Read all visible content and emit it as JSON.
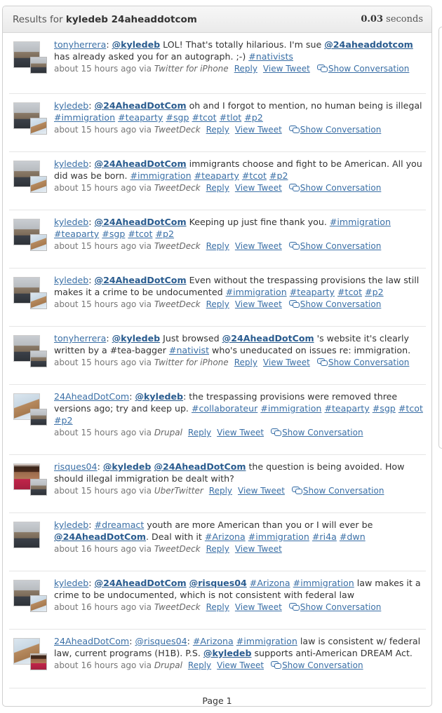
{
  "header": {
    "prefix": "Results for",
    "query": "kyledeb 24aheaddotcom",
    "time_value": "0.03",
    "time_unit": "seconds"
  },
  "meta_labels": {
    "reply": "Reply",
    "view": "View Tweet",
    "show": "Show Conversation",
    "via": "via"
  },
  "tweets": [
    {
      "user": "tonyherrera",
      "ago": "about 15 hours ago",
      "source": "Twitter for iPhone",
      "av1": "man",
      "av2": "man",
      "parts": [
        {
          "t": "user",
          "v": "tonyherrera"
        },
        {
          "t": "txt",
          "v": ": "
        },
        {
          "t": "mention",
          "v": "@kyledeb"
        },
        {
          "t": "txt",
          "v": " LOL! That's totally hilarious. I'm sue "
        },
        {
          "t": "mention",
          "v": "@24aheaddotcom"
        },
        {
          "t": "txt",
          "v": " has already asked you for an autograph. ;-) "
        },
        {
          "t": "hash",
          "v": "#nativists"
        }
      ],
      "show": true
    },
    {
      "user": "kyledeb",
      "ago": "about 15 hours ago",
      "source": "TweetDeck",
      "av1": "man",
      "av2": "liberty",
      "parts": [
        {
          "t": "user",
          "v": "kyledeb"
        },
        {
          "t": "txt",
          "v": ": "
        },
        {
          "t": "mention",
          "v": "@24AheadDotCom"
        },
        {
          "t": "txt",
          "v": " oh and I forgot to mention, no human being is illegal "
        },
        {
          "t": "hash",
          "v": "#immigration"
        },
        {
          "t": "txt",
          "v": " "
        },
        {
          "t": "hash",
          "v": "#teaparty"
        },
        {
          "t": "txt",
          "v": " "
        },
        {
          "t": "hash",
          "v": "#sgp"
        },
        {
          "t": "txt",
          "v": " "
        },
        {
          "t": "hash",
          "v": "#tcot"
        },
        {
          "t": "txt",
          "v": " "
        },
        {
          "t": "hash",
          "v": "#tlot"
        },
        {
          "t": "txt",
          "v": " "
        },
        {
          "t": "hash",
          "v": "#p2"
        }
      ],
      "show": true
    },
    {
      "user": "kyledeb",
      "ago": "about 15 hours ago",
      "source": "TweetDeck",
      "av1": "man",
      "av2": "liberty",
      "parts": [
        {
          "t": "user",
          "v": "kyledeb"
        },
        {
          "t": "txt",
          "v": ": "
        },
        {
          "t": "mention",
          "v": "@24AheadDotCom"
        },
        {
          "t": "txt",
          "v": " immigrants choose and fight to be American. All you did was be born. "
        },
        {
          "t": "hash",
          "v": "#immigration"
        },
        {
          "t": "txt",
          "v": " "
        },
        {
          "t": "hash",
          "v": "#teaparty"
        },
        {
          "t": "txt",
          "v": " "
        },
        {
          "t": "hash",
          "v": "#tcot"
        },
        {
          "t": "txt",
          "v": " "
        },
        {
          "t": "hash",
          "v": "#p2"
        }
      ],
      "show": true
    },
    {
      "user": "kyledeb",
      "ago": "about 15 hours ago",
      "source": "TweetDeck",
      "av1": "man",
      "av2": "liberty",
      "parts": [
        {
          "t": "user",
          "v": "kyledeb"
        },
        {
          "t": "txt",
          "v": ": "
        },
        {
          "t": "mention",
          "v": "@24AheadDotCom"
        },
        {
          "t": "txt",
          "v": " Keeping up just fine thank you. "
        },
        {
          "t": "hash",
          "v": "#immigration"
        },
        {
          "t": "txt",
          "v": " "
        },
        {
          "t": "hash",
          "v": "#teaparty"
        },
        {
          "t": "txt",
          "v": " "
        },
        {
          "t": "hash",
          "v": "#sgp"
        },
        {
          "t": "txt",
          "v": " "
        },
        {
          "t": "hash",
          "v": "#tcot"
        },
        {
          "t": "txt",
          "v": " "
        },
        {
          "t": "hash",
          "v": "#p2"
        }
      ],
      "show": true
    },
    {
      "user": "kyledeb",
      "ago": "about 15 hours ago",
      "source": "TweetDeck",
      "av1": "man",
      "av2": "liberty",
      "parts": [
        {
          "t": "user",
          "v": "kyledeb"
        },
        {
          "t": "txt",
          "v": ": "
        },
        {
          "t": "mention",
          "v": "@24AheadDotCom"
        },
        {
          "t": "txt",
          "v": " Even without the trespassing provisions the law still makes it a crime to be undocumented "
        },
        {
          "t": "hash",
          "v": "#immigration"
        },
        {
          "t": "txt",
          "v": " "
        },
        {
          "t": "hash",
          "v": "#teaparty"
        },
        {
          "t": "txt",
          "v": " "
        },
        {
          "t": "hash",
          "v": "#tcot"
        },
        {
          "t": "txt",
          "v": " "
        },
        {
          "t": "hash",
          "v": "#p2"
        }
      ],
      "show": true
    },
    {
      "user": "tonyherrera",
      "ago": "about 15 hours ago",
      "source": "Twitter for iPhone",
      "av1": "man",
      "av2": "man",
      "parts": [
        {
          "t": "user",
          "v": "tonyherrera"
        },
        {
          "t": "txt",
          "v": ": "
        },
        {
          "t": "mention",
          "v": "@kyledeb"
        },
        {
          "t": "txt",
          "v": " Just browsed "
        },
        {
          "t": "mention",
          "v": "@24AheadDotCom"
        },
        {
          "t": "txt",
          "v": " 's website it's clearly written by a #tea-bagger "
        },
        {
          "t": "hash",
          "v": "#nativist"
        },
        {
          "t": "txt",
          "v": " who's uneducated on issues re: immigration."
        }
      ],
      "show": true
    },
    {
      "user": "24AheadDotCom",
      "ago": "about 15 hours ago",
      "source": "Drupal",
      "av1": "liberty",
      "av2": "man",
      "parts": [
        {
          "t": "user",
          "v": "24AheadDotCom"
        },
        {
          "t": "txt",
          "v": ": "
        },
        {
          "t": "mention",
          "v": "@kyledeb"
        },
        {
          "t": "txt",
          "v": ": the trespassing provisions were removed three versions ago; try and keep up. "
        },
        {
          "t": "hash",
          "v": "#collaborateur"
        },
        {
          "t": "txt",
          "v": " "
        },
        {
          "t": "hash",
          "v": "#immigration"
        },
        {
          "t": "txt",
          "v": " "
        },
        {
          "t": "hash",
          "v": "#teaparty"
        },
        {
          "t": "txt",
          "v": " "
        },
        {
          "t": "hash",
          "v": "#sgp"
        },
        {
          "t": "txt",
          "v": " "
        },
        {
          "t": "hash",
          "v": "#tcot"
        },
        {
          "t": "txt",
          "v": " "
        },
        {
          "t": "hash",
          "v": "#p2"
        }
      ],
      "show": true
    },
    {
      "user": "risques04",
      "ago": "about 15 hours ago",
      "source": "UberTwitter",
      "av1": "woman",
      "av2": "man",
      "parts": [
        {
          "t": "user",
          "v": "risques04"
        },
        {
          "t": "txt",
          "v": ": "
        },
        {
          "t": "mention",
          "v": "@kyledeb"
        },
        {
          "t": "txt",
          "v": " "
        },
        {
          "t": "mention",
          "v": "@24AheadDotCom"
        },
        {
          "t": "txt",
          "v": " the question is being avoided. How should illegal immigration be dealt with?"
        }
      ],
      "show": true
    },
    {
      "user": "kyledeb",
      "ago": "about 16 hours ago",
      "source": "TweetDeck",
      "av1": "man",
      "av2": "",
      "parts": [
        {
          "t": "user",
          "v": "kyledeb"
        },
        {
          "t": "txt",
          "v": ": "
        },
        {
          "t": "hash",
          "v": "#dreamact"
        },
        {
          "t": "txt",
          "v": " youth are more American than you or I will ever be "
        },
        {
          "t": "mention",
          "v": "@24AheadDotCom"
        },
        {
          "t": "txt",
          "v": ". Deal with it "
        },
        {
          "t": "hash",
          "v": "#Arizona"
        },
        {
          "t": "txt",
          "v": " "
        },
        {
          "t": "hash",
          "v": "#immigration"
        },
        {
          "t": "txt",
          "v": " "
        },
        {
          "t": "hash",
          "v": "#ri4a"
        },
        {
          "t": "txt",
          "v": " "
        },
        {
          "t": "hash",
          "v": "#dwn"
        }
      ],
      "show": false
    },
    {
      "user": "kyledeb",
      "ago": "about 16 hours ago",
      "source": "TweetDeck",
      "av1": "man",
      "av2": "liberty",
      "parts": [
        {
          "t": "user",
          "v": "kyledeb"
        },
        {
          "t": "txt",
          "v": ": "
        },
        {
          "t": "mention",
          "v": "@24AheadDotCom"
        },
        {
          "t": "txt",
          "v": " "
        },
        {
          "t": "mention",
          "v": "@risques04"
        },
        {
          "t": "txt",
          "v": " "
        },
        {
          "t": "hash",
          "v": "#Arizona"
        },
        {
          "t": "txt",
          "v": " "
        },
        {
          "t": "hash",
          "v": "#immigration"
        },
        {
          "t": "txt",
          "v": " law makes it a crime to be undocumented, which is not consistent with federal law"
        }
      ],
      "show": true
    },
    {
      "user": "24AheadDotCom",
      "ago": "about 16 hours ago",
      "source": "Drupal",
      "av1": "liberty",
      "av2": "woman",
      "parts": [
        {
          "t": "user",
          "v": "24AheadDotCom"
        },
        {
          "t": "txt",
          "v": ": "
        },
        {
          "t": "user",
          "v": "@risques04"
        },
        {
          "t": "txt",
          "v": ": "
        },
        {
          "t": "hash",
          "v": "#Arizona"
        },
        {
          "t": "txt",
          "v": " "
        },
        {
          "t": "hash",
          "v": "#immigration"
        },
        {
          "t": "txt",
          "v": " law is consistent w/ federal law, current programs (H1B). P.S. "
        },
        {
          "t": "mention",
          "v": "@kyledeb"
        },
        {
          "t": "txt",
          "v": " supports anti-American DREAM Act."
        }
      ],
      "show": true
    }
  ],
  "pager": {
    "label": "Page 1"
  }
}
